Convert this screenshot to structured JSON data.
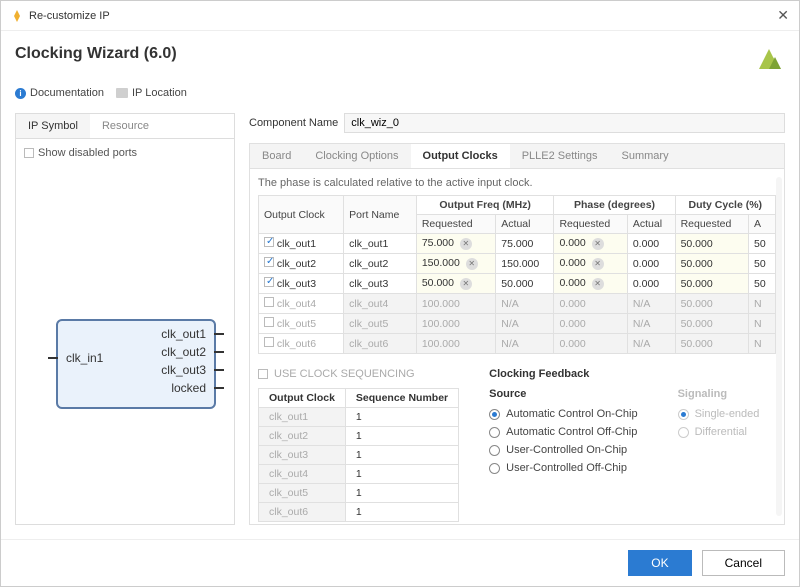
{
  "window": {
    "title": "Re-customize IP"
  },
  "header": {
    "title": "Clocking Wizard (6.0)",
    "doc": "Documentation",
    "iploc": "IP Location"
  },
  "leftTabs": {
    "symbol": "IP Symbol",
    "resource": "Resource"
  },
  "leftBody": {
    "showDisabled": "Show disabled ports"
  },
  "ipPorts": {
    "in": "clk_in1",
    "out1": "clk_out1",
    "out2": "clk_out2",
    "out3": "clk_out3",
    "locked": "locked"
  },
  "compName": {
    "label": "Component Name",
    "value": "clk_wiz_0"
  },
  "cfgTabs": {
    "board": "Board",
    "opts": "Clocking Options",
    "outclocks": "Output Clocks",
    "plle2": "PLLE2 Settings",
    "summary": "Summary"
  },
  "note": "The phase is calculated relative to the active input clock.",
  "headers": {
    "outclock": "Output Clock",
    "portname": "Port Name",
    "freqGroup": "Output Freq (MHz)",
    "phaseGroup": "Phase (degrees)",
    "dutyGroup": "Duty Cycle (%)",
    "req": "Requested",
    "act": "Actual",
    "actShort": "A"
  },
  "rows": [
    {
      "enabled": true,
      "name": "clk_out1",
      "port": "clk_out1",
      "freqReq": "75.000",
      "freqAct": "75.000",
      "phaseReq": "0.000",
      "phaseAct": "0.000",
      "dutyReq": "50.000",
      "dutyAct": "50"
    },
    {
      "enabled": true,
      "name": "clk_out2",
      "port": "clk_out2",
      "freqReq": "150.000",
      "freqAct": "150.000",
      "phaseReq": "0.000",
      "phaseAct": "0.000",
      "dutyReq": "50.000",
      "dutyAct": "50"
    },
    {
      "enabled": true,
      "name": "clk_out3",
      "port": "clk_out3",
      "freqReq": "50.000",
      "freqAct": "50.000",
      "phaseReq": "0.000",
      "phaseAct": "0.000",
      "dutyReq": "50.000",
      "dutyAct": "50"
    },
    {
      "enabled": false,
      "name": "clk_out4",
      "port": "clk_out4",
      "freqReq": "100.000",
      "freqAct": "N/A",
      "phaseReq": "0.000",
      "phaseAct": "N/A",
      "dutyReq": "50.000",
      "dutyAct": "N"
    },
    {
      "enabled": false,
      "name": "clk_out5",
      "port": "clk_out5",
      "freqReq": "100.000",
      "freqAct": "N/A",
      "phaseReq": "0.000",
      "phaseAct": "N/A",
      "dutyReq": "50.000",
      "dutyAct": "N"
    },
    {
      "enabled": false,
      "name": "clk_out6",
      "port": "clk_out6",
      "freqReq": "100.000",
      "freqAct": "N/A",
      "phaseReq": "0.000",
      "phaseAct": "N/A",
      "dutyReq": "50.000",
      "dutyAct": "N"
    }
  ],
  "seq": {
    "label": "USE CLOCK SEQUENCING",
    "h1": "Output Clock",
    "h2": "Sequence Number",
    "items": [
      {
        "name": "clk_out1",
        "num": "1"
      },
      {
        "name": "clk_out2",
        "num": "1"
      },
      {
        "name": "clk_out3",
        "num": "1"
      },
      {
        "name": "clk_out4",
        "num": "1"
      },
      {
        "name": "clk_out5",
        "num": "1"
      },
      {
        "name": "clk_out6",
        "num": "1"
      }
    ]
  },
  "feedback": {
    "title": "Clocking Feedback",
    "source": "Source",
    "signaling": "Signaling",
    "src": {
      "autoOn": "Automatic Control On-Chip",
      "autoOff": "Automatic Control Off-Chip",
      "userOn": "User-Controlled On-Chip",
      "userOff": "User-Controlled Off-Chip"
    },
    "sig": {
      "single": "Single-ended",
      "diff": "Differential"
    }
  },
  "footer": {
    "ok": "OK",
    "cancel": "Cancel"
  }
}
